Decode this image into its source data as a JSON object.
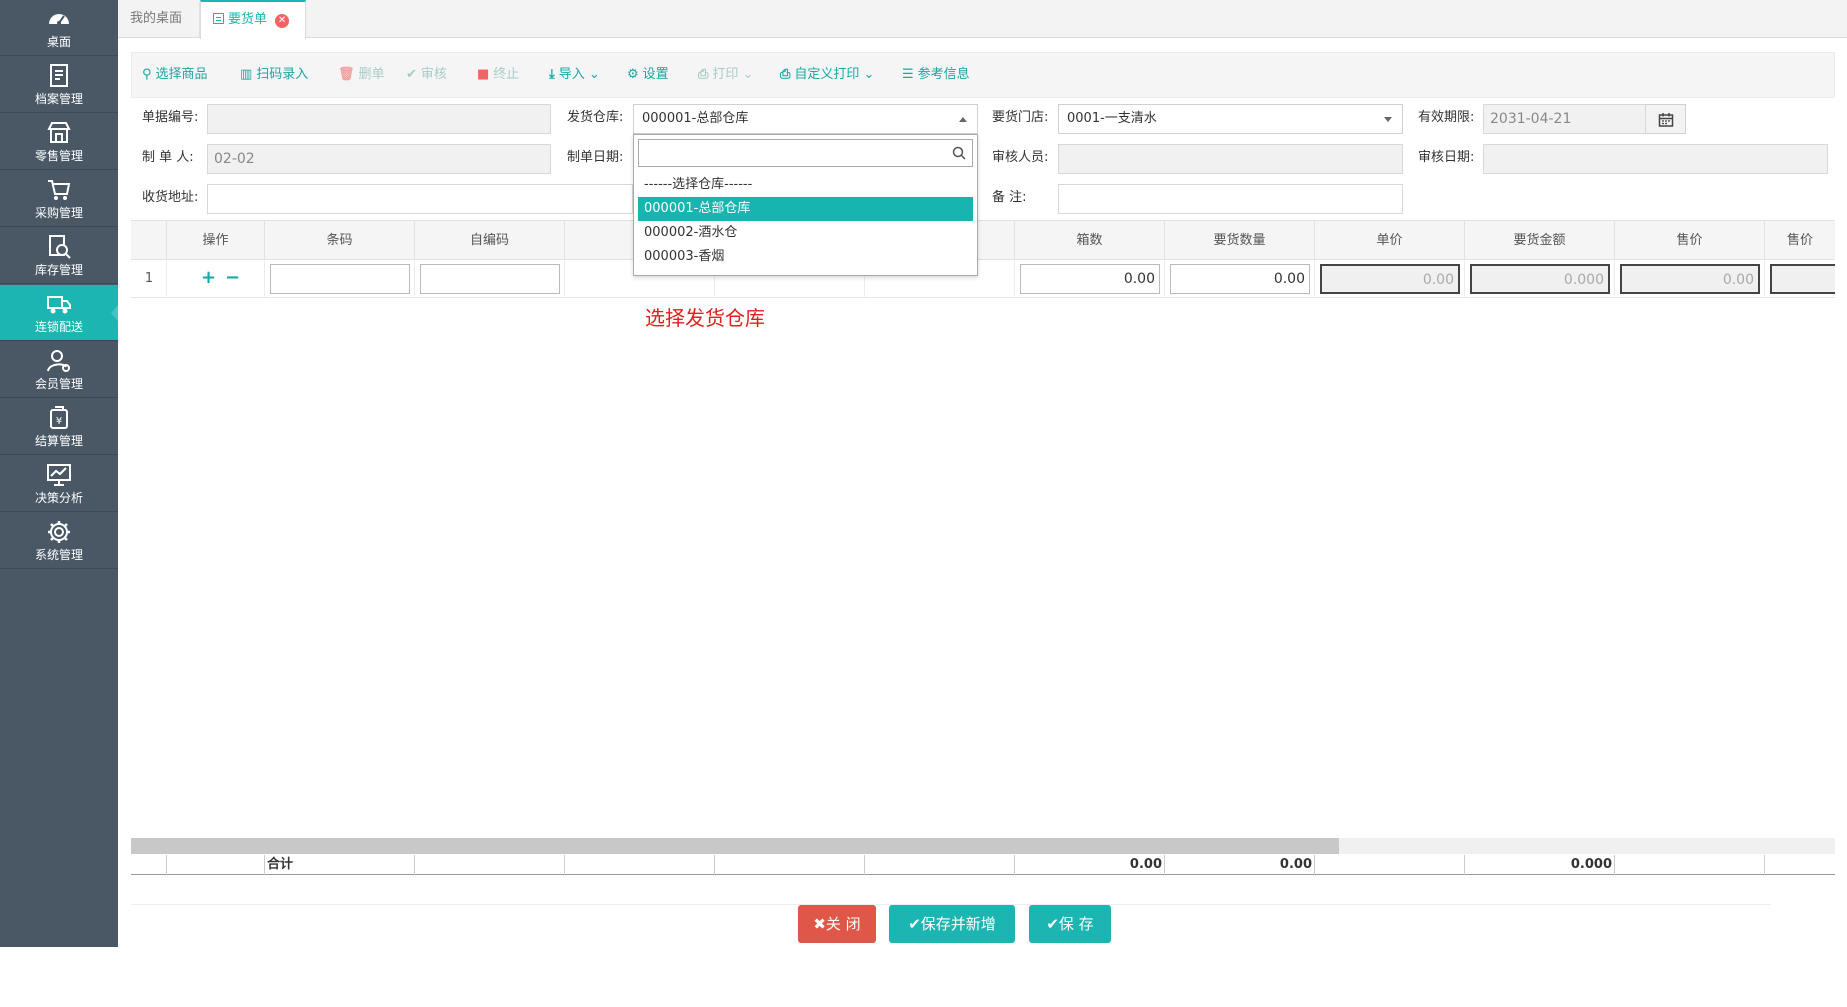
{
  "sidebar": {
    "items": [
      {
        "label": "桌面",
        "icon": "dashboard-icon"
      },
      {
        "label": "档案管理",
        "icon": "archive-icon"
      },
      {
        "label": "零售管理",
        "icon": "store-icon"
      },
      {
        "label": "采购管理",
        "icon": "cart-icon"
      },
      {
        "label": "库存管理",
        "icon": "inventory-search-icon"
      },
      {
        "label": "连锁配送",
        "icon": "delivery-truck-icon"
      },
      {
        "label": "会员管理",
        "icon": "member-icon"
      },
      {
        "label": "结算管理",
        "icon": "settlement-icon"
      },
      {
        "label": "决策分析",
        "icon": "chart-icon"
      },
      {
        "label": "系统管理",
        "icon": "gear-icon"
      }
    ],
    "active_index": 5
  },
  "tabs": [
    {
      "label": "我的桌面"
    },
    {
      "label": "要货单",
      "close": "✕"
    }
  ],
  "toolbar": {
    "select_goods": "选择商品",
    "scan_entry": "扫码录入",
    "delete": "删单",
    "approve": "审核",
    "terminate": "终止",
    "import": "导入",
    "settings": "设置",
    "print": "打印",
    "custom_print": "自定义打印",
    "reference": "参考信息"
  },
  "form": {
    "doc_no_label": "单据编号:",
    "doc_no_value": "",
    "warehouse_label": "发货仓库:",
    "warehouse_value": "000001-总部仓库",
    "store_label": "要货门店:",
    "store_value": "0001-一支清水",
    "expiry_label": "有效期限:",
    "expiry_value": "2031-04-21",
    "maker_label": "制 单 人:",
    "maker_value": "02-02",
    "make_date_label": "制单日期:",
    "approver_label": "审核人员:",
    "approve_date_label": "审核日期:",
    "address_label": "收货地址:",
    "remark_label": "备 注:"
  },
  "dropdown": {
    "search_placeholder": "",
    "options": [
      "------选择仓库------",
      "000001-总部仓库",
      "000002-酒水仓",
      "000003-香烟"
    ],
    "selected_index": 1
  },
  "grid": {
    "headers": [
      "操作",
      "条码",
      "自编码",
      "",
      "",
      "",
      "箱数",
      "要货数量",
      "单价",
      "要货金额",
      "售价",
      "售价"
    ],
    "row": {
      "num": "1",
      "plus": "+",
      "minus": "−",
      "boxes": "0.00",
      "qty": "0.00",
      "unit_price": "0.00",
      "amount": "0.000",
      "sale_price": "0.00"
    }
  },
  "totals": {
    "label": "合计",
    "boxes": "0.00",
    "qty": "0.00",
    "amount": "0.000"
  },
  "annotation": "选择发货仓库",
  "buttons": {
    "close": "✖关 闭",
    "save_new": "✔保存并新增",
    "save": "✔保 存"
  },
  "colors": {
    "sidebar": "#4a5866",
    "accent": "#1bb6b2",
    "danger": "#e0574a",
    "annotation": "#e02020"
  }
}
